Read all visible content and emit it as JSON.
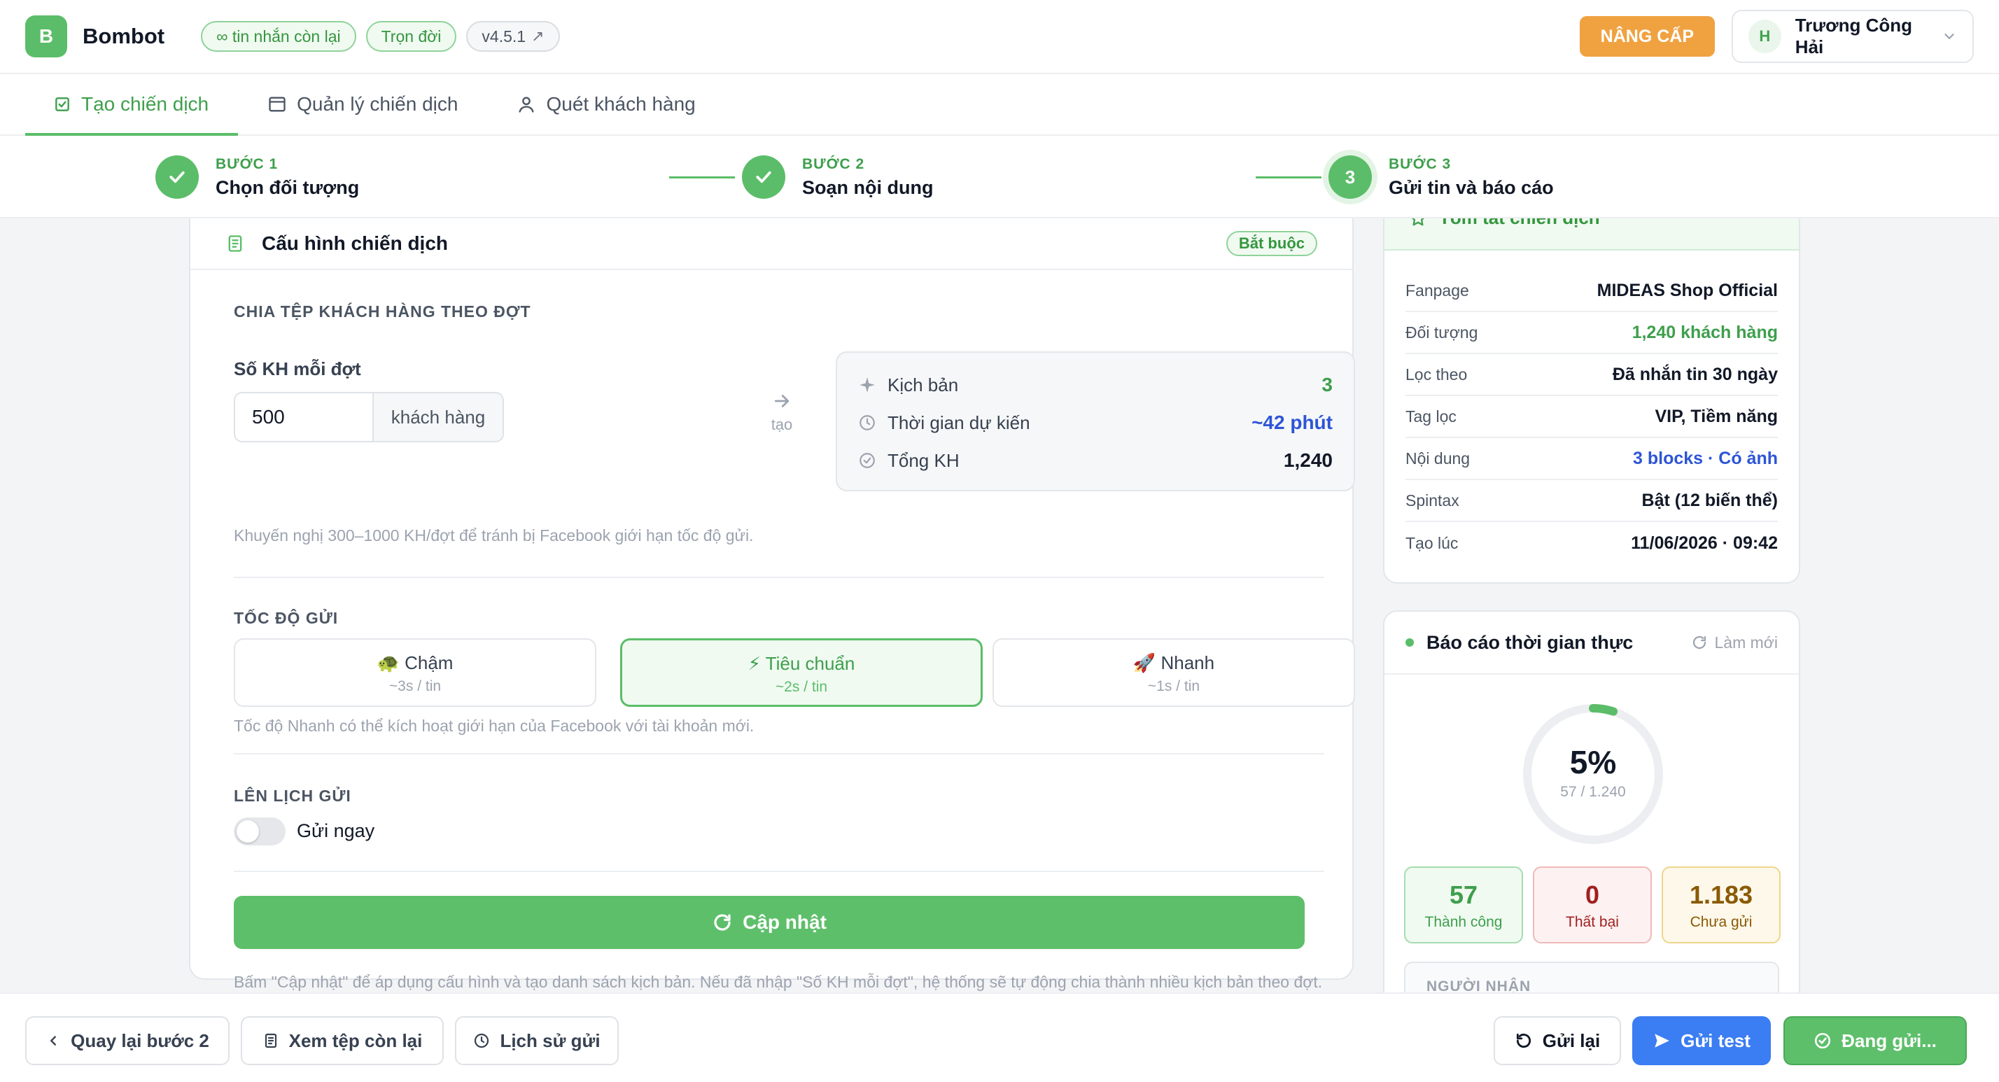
{
  "header": {
    "logo_letter": "B",
    "brand": "Bombot",
    "badges": {
      "messages": "∞ tin nhắn còn lại",
      "plan": "Trọn đời",
      "version": "v4.5.1",
      "version_arrow": "↗"
    },
    "upgrade_label": "NÂNG CẤP",
    "user": {
      "initial": "H",
      "name": "Trương Công Hải"
    }
  },
  "tabs": [
    {
      "label": "Tạo chiến dịch",
      "icon": "checkbox-icon",
      "active": true
    },
    {
      "label": "Quản lý chiến dịch",
      "icon": "calendar-icon",
      "active": false
    },
    {
      "label": "Quét khách hàng",
      "icon": "user-icon",
      "active": false
    }
  ],
  "stepper": [
    {
      "kicker": "BƯỚC 1",
      "title": "Chọn đối tượng",
      "state": "done"
    },
    {
      "kicker": "BƯỚC 2",
      "title": "Soạn nội dung",
      "state": "done"
    },
    {
      "kicker": "BƯỚC 3",
      "title": "Gửi tin và báo cáo",
      "state": "current",
      "number": "3"
    }
  ],
  "config": {
    "title": "Cấu hình chiến dịch",
    "required_badge": "Bắt buộc",
    "split": {
      "section_title": "CHIA TỆP KHÁCH HÀNG THEO ĐỢT",
      "field_label": "Số KH mỗi đợt",
      "value": "500",
      "suffix": "khách hàng",
      "arrow_label": "tạo",
      "summary": [
        {
          "label": "Kịch bản",
          "value": "3",
          "color": "#3e9f4c",
          "icon": "sparkle-icon"
        },
        {
          "label": "Thời gian dự kiến",
          "value": "~42 phút",
          "color": "#2e55d6",
          "icon": "clock-icon"
        },
        {
          "label": "Tổng KH",
          "value": "1,240",
          "color": "#111827",
          "icon": "check-circle-icon"
        }
      ],
      "hint": "Khuyến nghị 300–1000 KH/đợt để tránh bị Facebook giới hạn tốc độ gửi."
    },
    "speed": {
      "section_title": "TỐC ĐỘ GỬI",
      "options": [
        {
          "name": "🐢 Chậm",
          "sub": "~3s / tin",
          "active": false
        },
        {
          "name": "⚡ Tiêu chuẩn",
          "sub": "~2s / tin",
          "active": true
        },
        {
          "name": "🚀 Nhanh",
          "sub": "~1s / tin",
          "active": false
        }
      ],
      "hint": "Tốc độ Nhanh có thể kích hoạt giới hạn của Facebook với tài khoản mới."
    },
    "schedule": {
      "section_title": "LÊN LỊCH GỬI",
      "toggle_label": "Gửi ngay",
      "enabled": false
    },
    "update_label": "Cập nhật",
    "update_hint": "Bấm \"Cập nhật\" để áp dụng cấu hình và tạo danh sách kịch bản. Nếu đã nhập \"Số KH mỗi đợt\", hệ thống sẽ tự động chia thành nhiều kịch bản theo đợt."
  },
  "summary_card": {
    "title": "Tóm tắt chiến dịch",
    "rows": [
      {
        "key": "Fanpage",
        "value": "MIDEAS Shop Official",
        "tone": ""
      },
      {
        "key": "Đối tượng",
        "value": "1,240 khách hàng",
        "tone": "green"
      },
      {
        "key": "Lọc theo",
        "value": "Đã nhắn tin 30 ngày",
        "tone": ""
      },
      {
        "key": "Tag lọc",
        "value": "VIP, Tiềm năng",
        "tone": ""
      },
      {
        "key": "Nội dung",
        "value": "3 blocks · Có ảnh",
        "tone": "blue"
      },
      {
        "key": "Spintax",
        "value": "Bật (12 biến thể)",
        "tone": ""
      },
      {
        "key": "Tạo lúc",
        "value": "11/06/2026 · 09:42",
        "tone": ""
      }
    ]
  },
  "report": {
    "title": "Báo cáo thời gian thực",
    "refresh_label": "Làm mới",
    "progress_percent": 5,
    "percent_label": "5%",
    "progress_detail": "57 / 1.240",
    "stats": [
      {
        "value": "57",
        "label": "Thành công",
        "kind": "ok"
      },
      {
        "value": "0",
        "label": "Thất bại",
        "kind": "fail"
      },
      {
        "value": "1.183",
        "label": "Chưa gửi",
        "kind": "wait"
      }
    ],
    "recipients_label": "NGƯỜI NHẬN"
  },
  "footer": {
    "back_label": "Quay lại bước 2",
    "view_file_label": "Xem tệp còn lại",
    "history_label": "Lịch sử gửi",
    "resend_label": "Gửi lại",
    "test_label": "Gửi test",
    "sending_label": "Đang gửi..."
  },
  "colors": {
    "primary_green": "#5bbd69",
    "accent_orange": "#f0a241",
    "accent_blue": "#3b7df2"
  }
}
